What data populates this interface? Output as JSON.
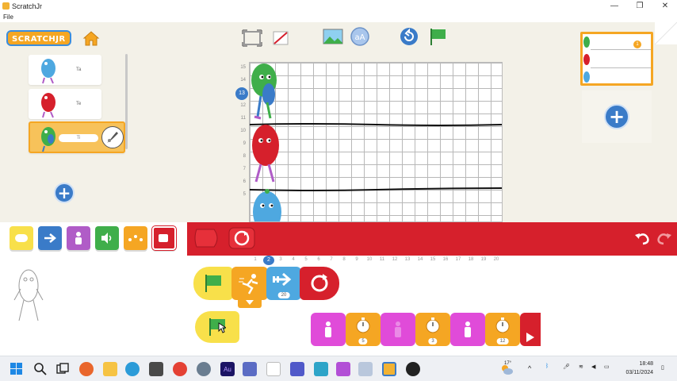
{
  "window": {
    "title": "ScratchJr",
    "menu": [
      "File"
    ],
    "controls": {
      "minimize": "—",
      "restore": "❐",
      "close": "✕"
    }
  },
  "toolbar": {
    "logo_text": "SCRATCHJR",
    "icons": [
      "home-icon",
      "fullscreen-icon",
      "grid-toggle-icon",
      "background-icon",
      "text-icon",
      "reset-icon",
      "green-flag-icon"
    ]
  },
  "characters": [
    {
      "name": "Ta",
      "color": "#4ea8e0"
    },
    {
      "name": "Te",
      "color": "#d6202c"
    },
    {
      "name": "Ti",
      "color": "#3fae4a",
      "selected": true
    }
  ],
  "stage": {
    "row_numbers": [
      "15",
      "14",
      "13",
      "12",
      "11",
      "10",
      "9",
      "8",
      "7",
      "6",
      "5"
    ],
    "selected_row": "13"
  },
  "pages": {
    "page_count_badge": "1"
  },
  "palette": {
    "categories": [
      {
        "name": "triggering",
        "color": "#f8e04a"
      },
      {
        "name": "motion",
        "color": "#3a7bc8"
      },
      {
        "name": "looks",
        "color": "#b05cc7"
      },
      {
        "name": "sound",
        "color": "#3fae4a"
      },
      {
        "name": "control",
        "color": "#f5a623"
      },
      {
        "name": "end",
        "color": "#d6202c"
      }
    ],
    "accent": "#d6202c"
  },
  "scripts": {
    "ruler": [
      "1",
      "2",
      "3",
      "4",
      "5",
      "6",
      "7",
      "8",
      "9",
      "10",
      "11",
      "12",
      "13",
      "14",
      "15",
      "16",
      "17",
      "18",
      "19",
      "20"
    ],
    "ruler_selected": "2",
    "script1": [
      {
        "type": "green-flag",
        "color": "#f8e04a"
      },
      {
        "type": "speed",
        "color": "#f5a623"
      },
      {
        "type": "move-right",
        "color": "#4ea8e0",
        "value": "20"
      },
      {
        "type": "repeat-forever",
        "color": "#d6202c"
      }
    ],
    "script2_values": [
      "5",
      "3",
      "12"
    ]
  },
  "taskbar": {
    "temperature": "17°",
    "time": "18:48",
    "date": "03/11/2024"
  }
}
